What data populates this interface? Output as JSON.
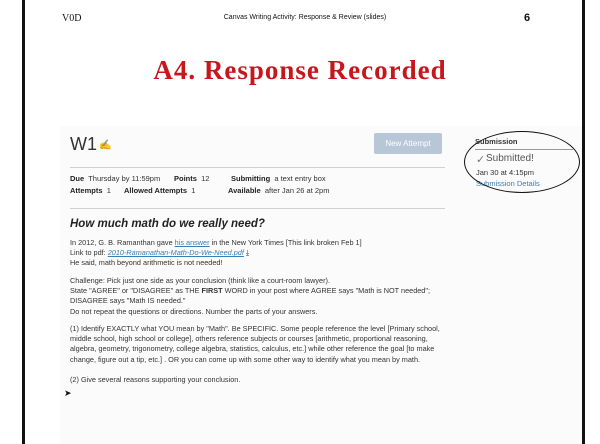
{
  "slide": {
    "header_left": "V0D",
    "header_center": "Canvas Writing Activity: Response & Review (slides)",
    "page_number": "6",
    "title": "A4.  Response Recorded"
  },
  "assignment": {
    "name": "W1",
    "new_attempt_label": "New Attempt",
    "meta": {
      "due_label": "Due",
      "due_value": "Thursday by 11:59pm",
      "points_label": "Points",
      "points_value": "12",
      "submitting_label": "Submitting",
      "submitting_value": "a text entry box",
      "attempts_label": "Attempts",
      "attempts_value": "1",
      "allowed_label": "Allowed Attempts",
      "allowed_value": "1",
      "available_label": "Available",
      "available_value": "after Jan 26 at 2pm"
    }
  },
  "submission": {
    "heading": "Submission",
    "status": "Submitted!",
    "date": "Jan 30 at 4:15pm",
    "details_link": "Submission Details"
  },
  "content": {
    "question_title": "How much math do we really need?",
    "p1_pre": "In 2012, G. B. Ramanthan gave ",
    "p1_link": "his answer",
    "p1_post": " in the New York Times  [This link broken Feb 1]",
    "p2_pre": "Link to pdf: ",
    "p2_link": "2010-Ramanathan-Math-Do-We-Need.pdf",
    "p3": "He said, math beyond arithmetic is not needed!",
    "p4": "Challenge: Pick just one side as your conclusion  (think like a court-room lawyer).",
    "p5_pre": "State \"AGREE\" or \"DISAGREE\" as THE ",
    "p5_bold": "FIRST",
    "p5_post": " WORD in your post where AGREE says \"Math is NOT needed\"; DISAGREE says \"Math IS needed.\"",
    "p6": "Do not repeat the questions or directions. Number the parts of your answers.",
    "p7": "(1) Identify EXACTLY what YOU mean by \"Math\". Be SPECIFIC. Some people reference the level [Primary school, middle school, high school or college], others reference subjects or courses [arithmetic, proportional reasoning, algebra, geometry, trigonometry, college algebra, statistics, calculus, etc.] while other reference the goal [to make change, figure out a tip, etc.] . OR you can come up with some other way to identify what you mean by math.",
    "p8": "(2) Give several reasons supporting your conclusion."
  }
}
